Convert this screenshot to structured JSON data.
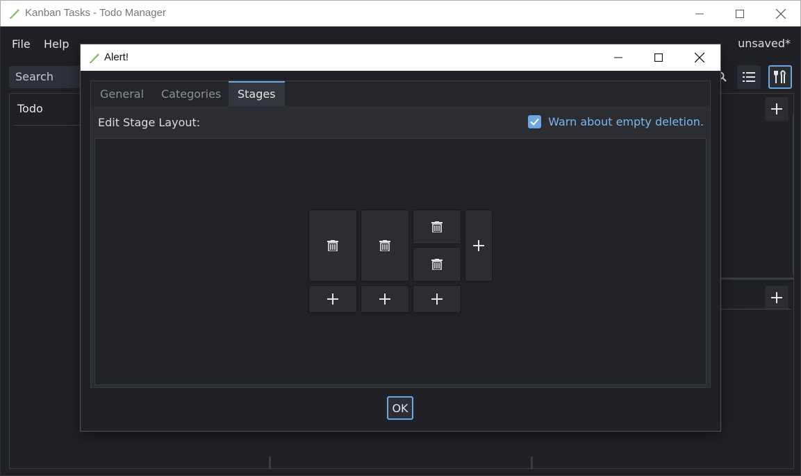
{
  "window": {
    "title": "Kanban Tasks - Todo Manager"
  },
  "menubar": {
    "file": "File",
    "help": "Help",
    "filename": "unsaved*"
  },
  "search": {
    "placeholder": "Search"
  },
  "board": {
    "column_title": "Todo"
  },
  "dialog": {
    "title": "Alert!",
    "tabs": [
      "General",
      "Categories",
      "Stages"
    ],
    "active_tab": "Stages",
    "edit_label": "Edit Stage Layout:",
    "warn_checkbox": {
      "label": "Warn about empty deletion.",
      "checked": true
    },
    "ok_label": "OK"
  },
  "colors": {
    "accent": "#6ea6e0",
    "background": "#202126",
    "panel": "#2b2d33"
  },
  "icons": {
    "delete": "trash-icon",
    "add": "plus-icon",
    "list": "list-icon",
    "settings": "tools-icon"
  }
}
